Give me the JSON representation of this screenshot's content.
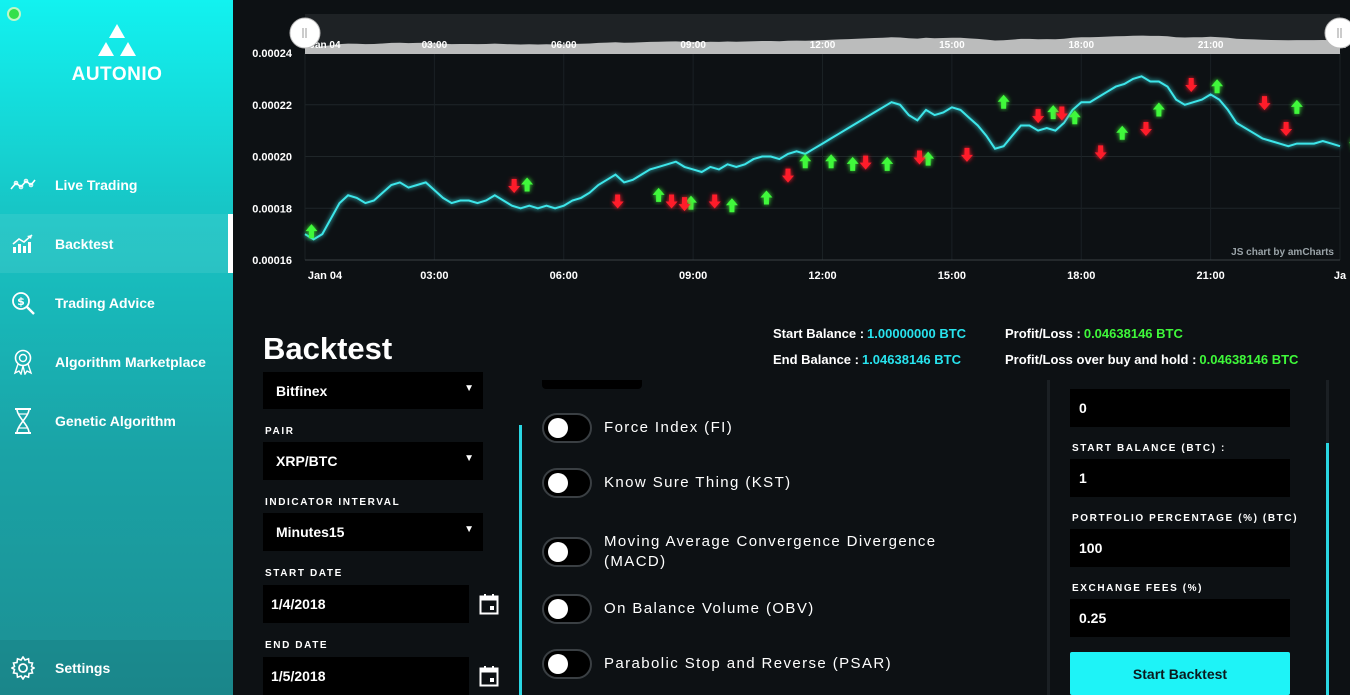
{
  "sidebar": {
    "logo_text": "AUTONIO",
    "items": [
      {
        "label": "Live Trading",
        "icon": "line-chart-icon"
      },
      {
        "label": "Backtest",
        "icon": "bar-chart-icon",
        "active": true
      },
      {
        "label": "Trading Advice",
        "icon": "dollar-search-icon"
      },
      {
        "label": "Algorithm Marketplace",
        "icon": "award-icon"
      },
      {
        "label": "Genetic Algorithm",
        "icon": "dna-icon"
      }
    ],
    "settings_label": "Settings"
  },
  "chart": {
    "credit": "JS chart by amCharts",
    "chart_data": {
      "type": "line",
      "x_labels": [
        "Jan 04",
        "03:00",
        "06:00",
        "09:00",
        "12:00",
        "15:00",
        "18:00",
        "21:00",
        "Ja"
      ],
      "y_ticks": [
        "0.00024",
        "0.00022",
        "0.00020",
        "0.00018",
        "0.00016"
      ],
      "ylim": [
        0.00016,
        0.00024
      ],
      "x_hours": [
        0,
        0.2,
        0.4,
        0.6,
        0.8,
        1.0,
        1.2,
        1.4,
        1.6,
        1.8,
        2.0,
        2.2,
        2.4,
        2.6,
        2.8,
        3.0,
        3.2,
        3.4,
        3.6,
        3.8,
        4.0,
        4.2,
        4.4,
        4.6,
        4.8,
        5.0,
        5.2,
        5.4,
        5.6,
        5.8,
        6.0,
        6.2,
        6.4,
        6.6,
        6.8,
        7.0,
        7.2,
        7.4,
        7.6,
        7.8,
        8.0,
        8.2,
        8.4,
        8.6,
        8.8,
        9.0,
        9.2,
        9.4,
        9.6,
        9.8,
        10.0,
        10.2,
        10.4,
        10.6,
        10.8,
        11.0,
        11.2,
        11.4,
        11.6,
        11.8,
        12.0,
        12.2,
        12.4,
        12.6,
        12.8,
        13.0,
        13.2,
        13.4,
        13.6,
        13.8,
        14.0,
        14.2,
        14.4,
        14.6,
        14.8,
        15.0,
        15.2,
        15.4,
        15.6,
        15.8,
        16.0,
        16.2,
        16.4,
        16.6,
        16.8,
        17.0,
        17.2,
        17.4,
        17.6,
        17.8,
        18.0,
        18.2,
        18.4,
        18.6,
        18.8,
        19.0,
        19.2,
        19.4,
        19.6,
        19.8,
        20.0,
        20.2,
        20.4,
        20.6,
        20.8,
        21.0,
        21.2,
        21.4,
        21.6,
        21.8,
        22.0,
        22.2,
        22.4,
        22.6,
        22.8,
        23.0,
        23.2,
        23.4,
        23.6,
        23.8,
        24.0
      ],
      "values": [
        0.00017,
        0.000168,
        0.00017,
        0.000176,
        0.000182,
        0.000185,
        0.000184,
        0.000182,
        0.000183,
        0.000186,
        0.000189,
        0.00019,
        0.000188,
        0.000189,
        0.00019,
        0.000187,
        0.000184,
        0.000182,
        0.000183,
        0.000183,
        0.000182,
        0.000183,
        0.000185,
        0.000183,
        0.000181,
        0.00018,
        0.000181,
        0.00018,
        0.000181,
        0.00018,
        0.000181,
        0.000183,
        0.000184,
        0.000186,
        0.000189,
        0.000191,
        0.000193,
        0.00019,
        0.000191,
        0.000193,
        0.000195,
        0.000196,
        0.000197,
        0.000198,
        0.000196,
        0.000195,
        0.000194,
        0.000196,
        0.000195,
        0.000197,
        0.000196,
        0.000197,
        0.000199,
        0.0002,
        0.0002,
        0.000199,
        0.000201,
        0.000202,
        0.000201,
        0.000203,
        0.000205,
        0.000207,
        0.000209,
        0.000211,
        0.000213,
        0.000215,
        0.000217,
        0.000219,
        0.000221,
        0.00022,
        0.000216,
        0.000214,
        0.000218,
        0.000216,
        0.000217,
        0.000219,
        0.000218,
        0.000215,
        0.000212,
        0.000208,
        0.000203,
        0.000204,
        0.000208,
        0.000212,
        0.000212,
        0.00021,
        0.000211,
        0.00021,
        0.000213,
        0.000218,
        0.000221,
        0.000221,
        0.000223,
        0.000225,
        0.000227,
        0.000228,
        0.00023,
        0.000231,
        0.000229,
        0.000229,
        0.000227,
        0.000222,
        0.00022,
        0.000221,
        0.000222,
        0.000224,
        0.000222,
        0.000218,
        0.000213,
        0.000211,
        0.000209,
        0.000207,
        0.000206,
        0.000205,
        0.000204,
        0.000205,
        0.000205,
        0.000205,
        0.000206,
        0.000205,
        0.000204
      ],
      "buy_signals": [
        [
          0.3,
          0.00017
        ],
        [
          10.3,
          0.000188
        ],
        [
          16.4,
          0.000184
        ],
        [
          17.9,
          0.000181
        ],
        [
          19.8,
          0.00018
        ],
        [
          21.4,
          0.000183
        ],
        [
          23.2,
          0.000197
        ],
        [
          24.4,
          0.000197
        ],
        [
          25.4,
          0.000196
        ],
        [
          27.0,
          0.000196
        ],
        [
          28.9,
          0.000198
        ],
        [
          32.4,
          0.00022
        ],
        [
          34.7,
          0.000216
        ],
        [
          35.7,
          0.000214
        ],
        [
          37.9,
          0.000208
        ],
        [
          39.6,
          0.000217
        ],
        [
          42.3,
          0.000226
        ],
        [
          46.0,
          0.000218
        ],
        [
          48.7,
          0.000204
        ]
      ],
      "sell_signals": [
        [
          9.7,
          0.000189
        ],
        [
          14.5,
          0.000183
        ],
        [
          17.0,
          0.000183
        ],
        [
          17.6,
          0.000182
        ],
        [
          19.0,
          0.000183
        ],
        [
          22.4,
          0.000193
        ],
        [
          26.0,
          0.000198
        ],
        [
          28.5,
          0.0002
        ],
        [
          30.7,
          0.000201
        ],
        [
          34.0,
          0.000216
        ],
        [
          35.1,
          0.000217
        ],
        [
          36.9,
          0.000202
        ],
        [
          39.0,
          0.000211
        ],
        [
          41.1,
          0.000228
        ],
        [
          44.5,
          0.000221
        ],
        [
          45.5,
          0.000211
        ]
      ]
    }
  },
  "backtest": {
    "title": "Backtest",
    "start_balance_label": "Start Balance :",
    "start_balance_value": "1.00000000 BTC",
    "end_balance_label": "End Balance :",
    "end_balance_value": "1.04638146 BTC",
    "profit_loss_label": "Profit/Loss :",
    "profit_loss_value": "0.04638146 BTC",
    "profit_loss_hold_label": "Profit/Loss over buy and hold :",
    "profit_loss_hold_value": "0.04638146 BTC",
    "exchange_value": "Bitfinex",
    "pair_label": "PAIR",
    "pair_value": "XRP/BTC",
    "interval_label": "INDICATOR INTERVAL",
    "interval_value": "Minutes15",
    "start_date_label": "START DATE",
    "start_date_value": "1/4/2018",
    "end_date_label": "END DATE",
    "end_date_value": "1/5/2018",
    "indicators": [
      {
        "label": "Force Index (FI)",
        "on": false
      },
      {
        "label": "Know Sure Thing (KST)",
        "on": false
      },
      {
        "label": "Moving Average Convergence Divergence (MACD)",
        "on": false
      },
      {
        "label": "On Balance Volume (OBV)",
        "on": false
      },
      {
        "label": "Parabolic Stop and Reverse (PSAR)",
        "on": false
      }
    ],
    "top_field_value": "0",
    "start_balance_btc_label": "START BALANCE (BTC) :",
    "start_balance_btc_value": "1",
    "portfolio_pct_label": "PORTFOLIO PERCENTAGE (%) (BTC)",
    "portfolio_pct_value": "100",
    "exchange_fees_label": "EXCHANGE FEES (%)",
    "exchange_fees_value": "0.25",
    "start_button_label": "Start Backtest"
  }
}
